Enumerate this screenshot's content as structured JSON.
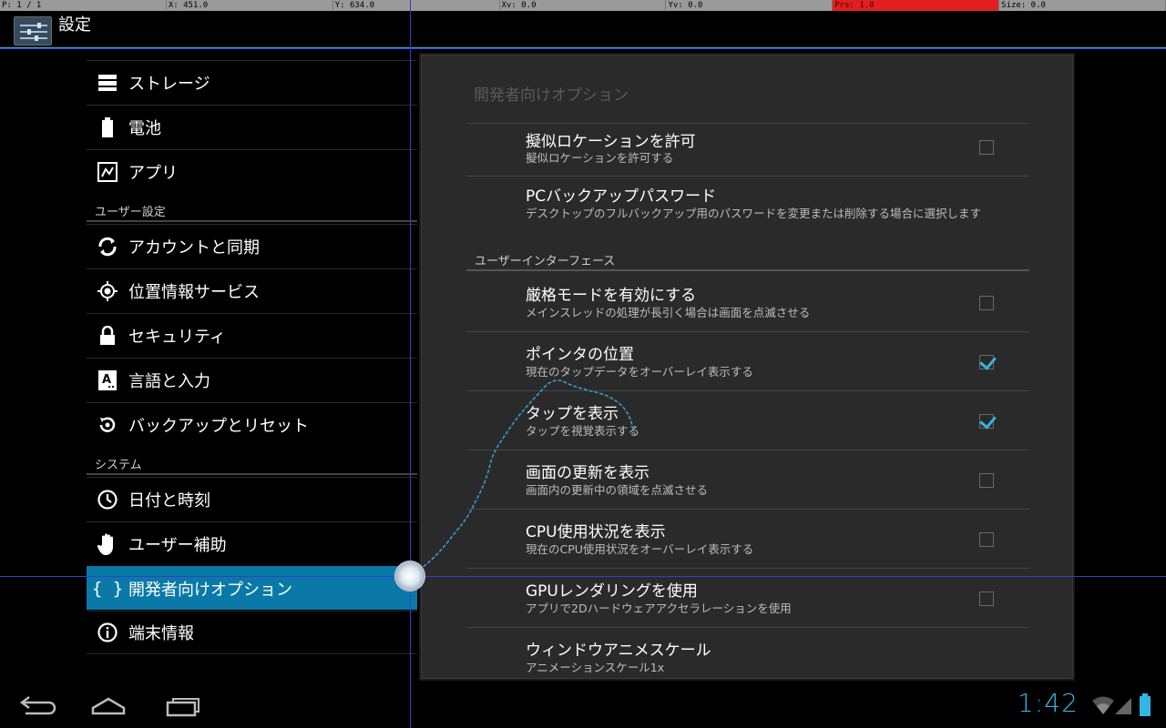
{
  "pointer_bar": {
    "p": "P: 1 / 1",
    "x": "X: 451.0",
    "y": "Y: 634.0",
    "xv": "Xv: 0.0",
    "yv": "Yv: 0.0",
    "prs": "Prs: 1.0",
    "size": "Size: 0.0"
  },
  "action_bar": {
    "title": "設定",
    "icon": "settings-sliders-icon"
  },
  "sidebar": {
    "items": [
      {
        "label": "ストレージ",
        "icon": "storage-icon"
      },
      {
        "label": "電池",
        "icon": "battery-icon"
      },
      {
        "label": "アプリ",
        "icon": "apps-icon"
      },
      {
        "label": "アカウントと同期",
        "icon": "sync-icon"
      },
      {
        "label": "位置情報サービス",
        "icon": "location-icon"
      },
      {
        "label": "セキュリティ",
        "icon": "lock-icon"
      },
      {
        "label": "言語と入力",
        "icon": "language-icon"
      },
      {
        "label": "バックアップとリセット",
        "icon": "backup-icon"
      },
      {
        "label": "日付と時刻",
        "icon": "clock-icon"
      },
      {
        "label": "ユーザー補助",
        "icon": "hand-icon"
      },
      {
        "label": "開発者向けオプション",
        "icon": "braces-icon"
      },
      {
        "label": "端末情報",
        "icon": "info-icon"
      }
    ],
    "headers": {
      "user_settings": "ユーザー設定",
      "system": "システム"
    }
  },
  "detail": {
    "title": "開発者向けオプション",
    "category_ui": "ユーザーインターフェース",
    "prefs": [
      {
        "title": "擬似ロケーションを許可",
        "summary": "擬似ロケーションを許可する",
        "checked": false
      },
      {
        "title": "PCバックアップパスワード",
        "summary": "デスクトップのフルバックアップ用のパスワードを変更または削除する場合に選択します"
      },
      {
        "title": "厳格モードを有効にする",
        "summary": "メインスレッドの処理が長引く場合は画面を点滅させる",
        "checked": false
      },
      {
        "title": "ポインタの位置",
        "summary": "現在のタップデータをオーバーレイ表示する",
        "checked": true
      },
      {
        "title": "タップを表示",
        "summary": "タップを視覚表示する",
        "checked": true
      },
      {
        "title": "画面の更新を表示",
        "summary": "画面内の更新中の領域を点滅させる",
        "checked": false
      },
      {
        "title": "CPU使用状況を表示",
        "summary": "現在のCPU使用状況をオーバーレイ表示する",
        "checked": false
      },
      {
        "title": "GPUレンダリングを使用",
        "summary": "アプリで2Dハードウェアアクセラレーションを使用",
        "checked": false
      },
      {
        "title": "ウィンドウアニメスケール",
        "summary": "アニメーションスケール1x"
      }
    ]
  },
  "nav_bar": {
    "back": "back-icon",
    "home": "home-icon",
    "recents": "recents-icon",
    "clock": "1:42"
  },
  "colors": {
    "accent": "#33b5e5",
    "selected": "#0a79a8",
    "pressure": "#e02020"
  }
}
